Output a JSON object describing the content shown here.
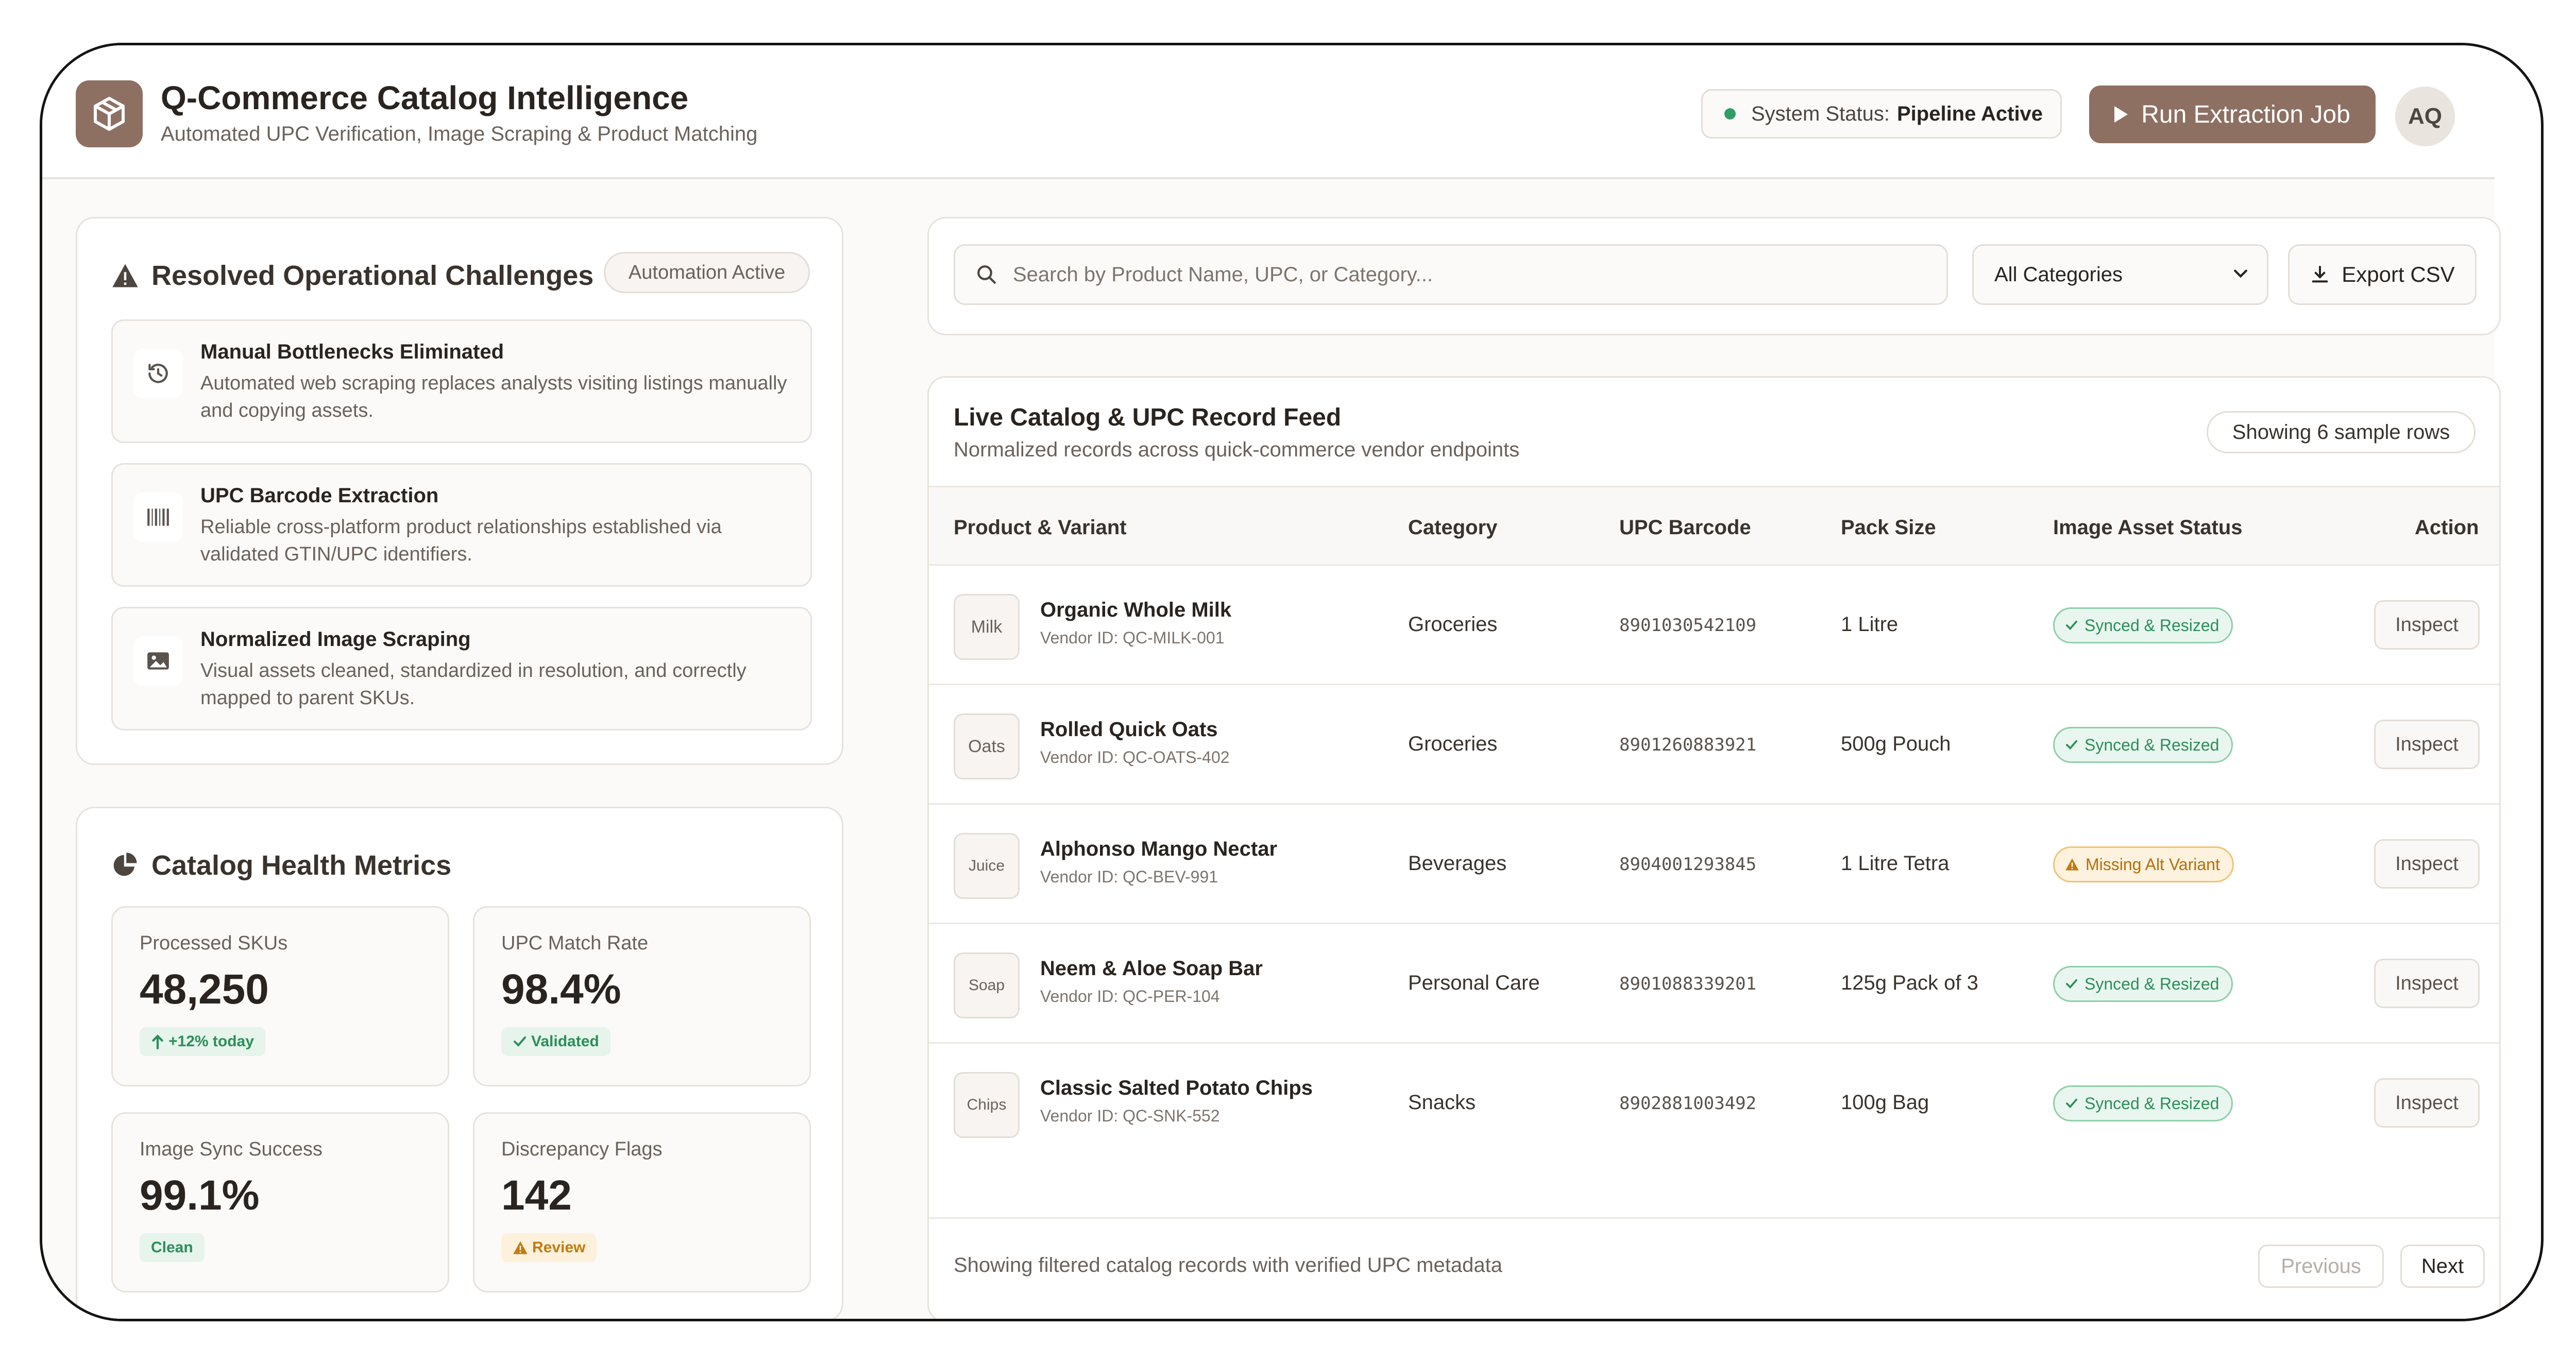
{
  "header": {
    "title": "Q-Commerce Catalog Intelligence",
    "subtitle": "Automated UPC Verification, Image Scraping & Product Matching",
    "status_label": "System Status:",
    "status_value": "Pipeline Active",
    "run_button": "Run Extraction Job",
    "avatar_initials": "AQ"
  },
  "challenges": {
    "title": "Resolved Operational Challenges",
    "badge": "Automation Active",
    "items": [
      {
        "icon": "history-icon",
        "title": "Manual Bottlenecks Eliminated",
        "desc": "Automated web scraping replaces analysts visiting listings manually and copying assets."
      },
      {
        "icon": "barcode-icon",
        "title": "UPC Barcode Extraction",
        "desc": "Reliable cross-platform product relationships established via validated GTIN/UPC identifiers."
      },
      {
        "icon": "image-icon",
        "title": "Normalized Image Scraping",
        "desc": "Visual assets cleaned, standardized in resolution, and correctly mapped to parent SKUs."
      }
    ]
  },
  "metrics": {
    "title": "Catalog Health Metrics",
    "items": [
      {
        "label": "Processed SKUs",
        "value": "48,250",
        "badge": "+12% today",
        "tone": "green"
      },
      {
        "label": "UPC Match Rate",
        "value": "98.4%",
        "badge": "Validated",
        "tone": "green"
      },
      {
        "label": "Image Sync Success",
        "value": "99.1%",
        "badge": "Clean",
        "tone": "green"
      },
      {
        "label": "Discrepancy Flags",
        "value": "142",
        "badge": "Review",
        "tone": "amber"
      }
    ]
  },
  "search": {
    "placeholder": "Search by Product Name, UPC, or Category...",
    "category_selected": "All Categories",
    "export_label": "Export CSV"
  },
  "feed": {
    "title": "Live Catalog & UPC Record Feed",
    "subtitle": "Normalized records across quick-commerce vendor endpoints",
    "rows_badge": "Showing 6 sample rows",
    "columns": [
      "Product & Variant",
      "Category",
      "UPC Barcode",
      "Pack Size",
      "Image Asset Status",
      "Action"
    ],
    "rows": [
      {
        "thumb": "Milk",
        "name": "Organic Whole Milk",
        "vendor": "Vendor ID: QC-MILK-001",
        "category": "Groceries",
        "upc": "8901030542109",
        "pack": "1 Litre",
        "status": "Synced & Resized",
        "status_tone": "ok",
        "action": "Inspect"
      },
      {
        "thumb": "Oats",
        "name": "Rolled Quick Oats",
        "vendor": "Vendor ID: QC-OATS-402",
        "category": "Groceries",
        "upc": "8901260883921",
        "pack": "500g Pouch",
        "status": "Synced & Resized",
        "status_tone": "ok",
        "action": "Inspect"
      },
      {
        "thumb": "Juice",
        "name": "Alphonso Mango Nectar",
        "vendor": "Vendor ID: QC-BEV-991",
        "category": "Beverages",
        "upc": "8904001293845",
        "pack": "1 Litre Tetra",
        "status": "Missing Alt Variant",
        "status_tone": "warn",
        "action": "Inspect"
      },
      {
        "thumb": "Soap",
        "name": "Neem & Aloe Soap Bar",
        "vendor": "Vendor ID: QC-PER-104",
        "category": "Personal Care",
        "upc": "8901088339201",
        "pack": "125g Pack of 3",
        "status": "Synced & Resized",
        "status_tone": "ok",
        "action": "Inspect"
      },
      {
        "thumb": "Chips",
        "name": "Classic Salted Potato Chips",
        "vendor": "Vendor ID: QC-SNK-552",
        "category": "Snacks",
        "upc": "8902881003492",
        "pack": "100g Bag",
        "status": "Synced & Resized",
        "status_tone": "ok",
        "action": "Inspect"
      }
    ],
    "footer_text": "Showing filtered catalog records with verified UPC metadata",
    "prev_label": "Previous",
    "next_label": "Next"
  },
  "colors": {
    "accent": "#8e7063",
    "success": "#2b8f58",
    "warning": "#c27b10",
    "status_dot": "#2f9e63"
  }
}
